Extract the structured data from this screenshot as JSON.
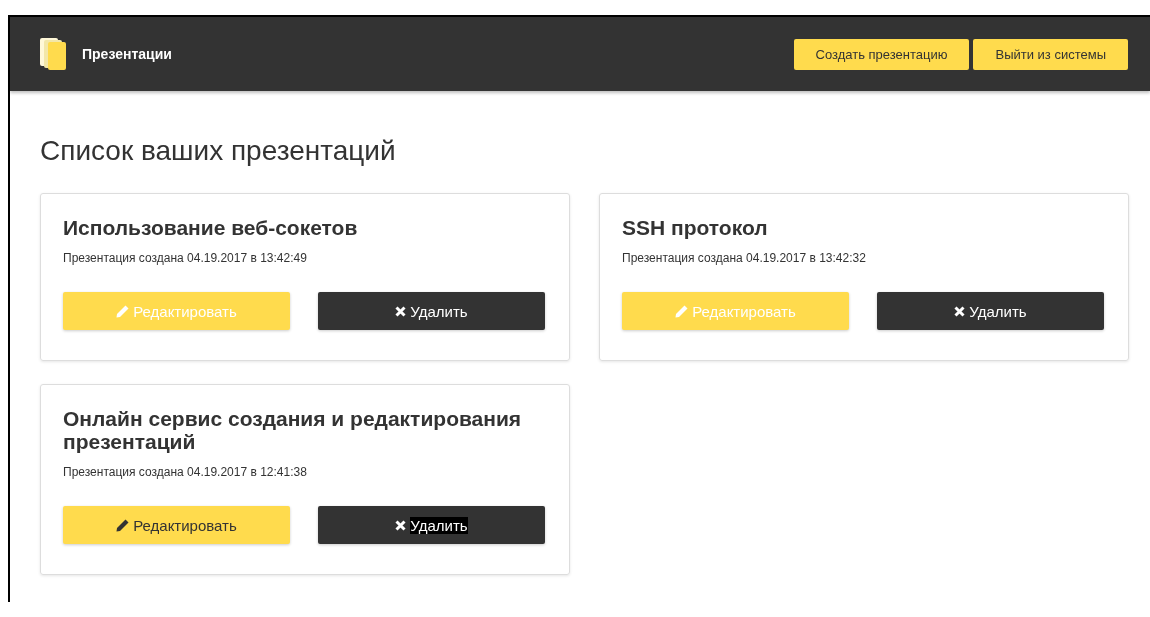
{
  "header": {
    "brand": "Презентации",
    "buttons": [
      "Создать презентацию",
      "Выйти из системы"
    ]
  },
  "page_title": "Список ваших презентаций",
  "presentations": [
    {
      "title": "Использование веб-сокетов",
      "created": "Презентация создана 04.19.2017 в 13:42:49",
      "edit_label": "Редактировать",
      "edit_disabled": true,
      "delete_label": "Удалить",
      "delete_text_selected": false
    },
    {
      "title": "SSH протокол",
      "created": "Презентация создана 04.19.2017 в 13:42:32",
      "edit_label": "Редактировать",
      "edit_disabled": true,
      "delete_label": "Удалить",
      "delete_text_selected": false
    },
    {
      "title": "Онлайн сервис создания и редактирования презентаций",
      "created": "Презентация создана 04.19.2017 в 12:41:38",
      "edit_label": "Редактировать",
      "edit_disabled": false,
      "delete_label": "Удалить",
      "delete_text_selected": true
    }
  ]
}
